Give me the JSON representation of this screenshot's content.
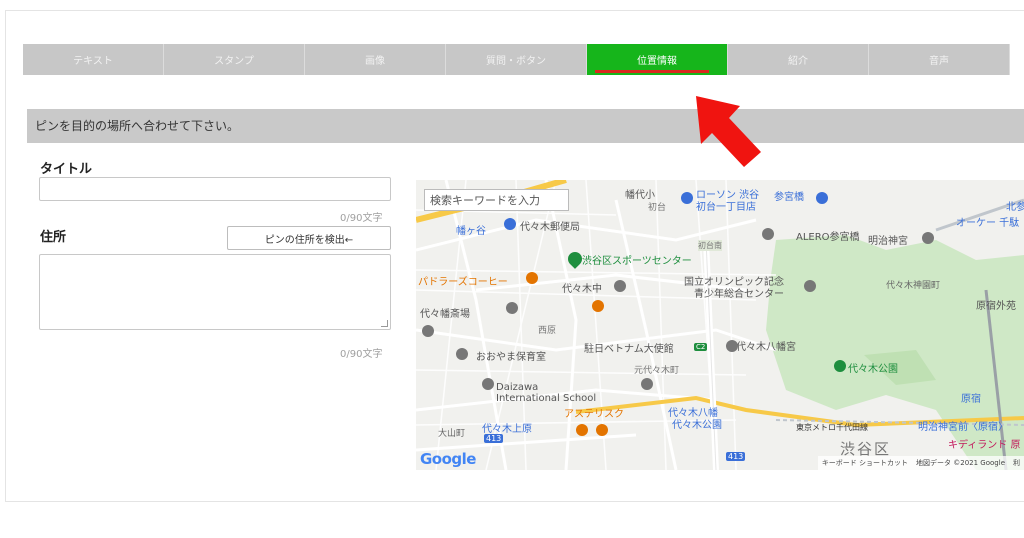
{
  "tabs": [
    "テキスト",
    "スタンプ",
    "画像",
    "質問・ボタン",
    "位置情報",
    "紹介",
    "音声"
  ],
  "active_tab": "位置情報",
  "instruction": "ピンを目的の場所へ合わせて下さい。",
  "form": {
    "title_label": "タイトル",
    "title_value": "",
    "title_counter": "0/90文字",
    "address_label": "住所",
    "detect_button": "ピンの住所を検出←",
    "address_value": "",
    "address_counter": "0/90文字"
  },
  "map": {
    "search_placeholder": "検索キーワードを入力",
    "labels": {
      "l1": "幡代小",
      "l2": "初台",
      "l3": "ローソン 渋谷",
      "l4": "初台一丁目店",
      "l5": "参宮橋",
      "l6": "北参",
      "l7": "オーケー 千駄",
      "l8": "幡ヶ谷",
      "l9": "代々木郵便局",
      "l10": "ALERO参宮橋",
      "l11": "明治神宮",
      "l12": "渋谷区スポーツセンター",
      "l13": "初台南",
      "l14": "国立オリンピック記念",
      "l15": "青少年総合センター",
      "l16": "パドラーズコーヒー",
      "l17": "代々木中",
      "l18": "代々木神園町",
      "l19": "原宿外苑",
      "l20": "代々幡斎場",
      "l21": "西原",
      "l22": "駐日ベトナム大使館",
      "l23": "代々木八幡宮",
      "l24": "おおやま保育室",
      "l25": "元代々木町",
      "l26": "代々木公園",
      "l27": "Daizawa",
      "l28": "International School",
      "l29": "アステリスク",
      "l30": "代々木八幡",
      "l31": "代々木公園",
      "l32": "東京メトロ千代田線",
      "l33": "明治神宮前〈原宿〉",
      "l34": "大山町",
      "l35": "代々木上原",
      "l36": "渋谷区",
      "l37": "キディランド 原",
      "l38": "原宿",
      "l39": "413",
      "l40": "413",
      "l41": "C2"
    },
    "logo": "Google",
    "credits": [
      "キーボード ショートカット",
      "地図データ ©2021 Google",
      "利"
    ]
  },
  "colors": {
    "active_tab": "#16b51b",
    "active_underline": "#d9291f",
    "arrow": "#f01410",
    "park": "#cfe8c6"
  }
}
